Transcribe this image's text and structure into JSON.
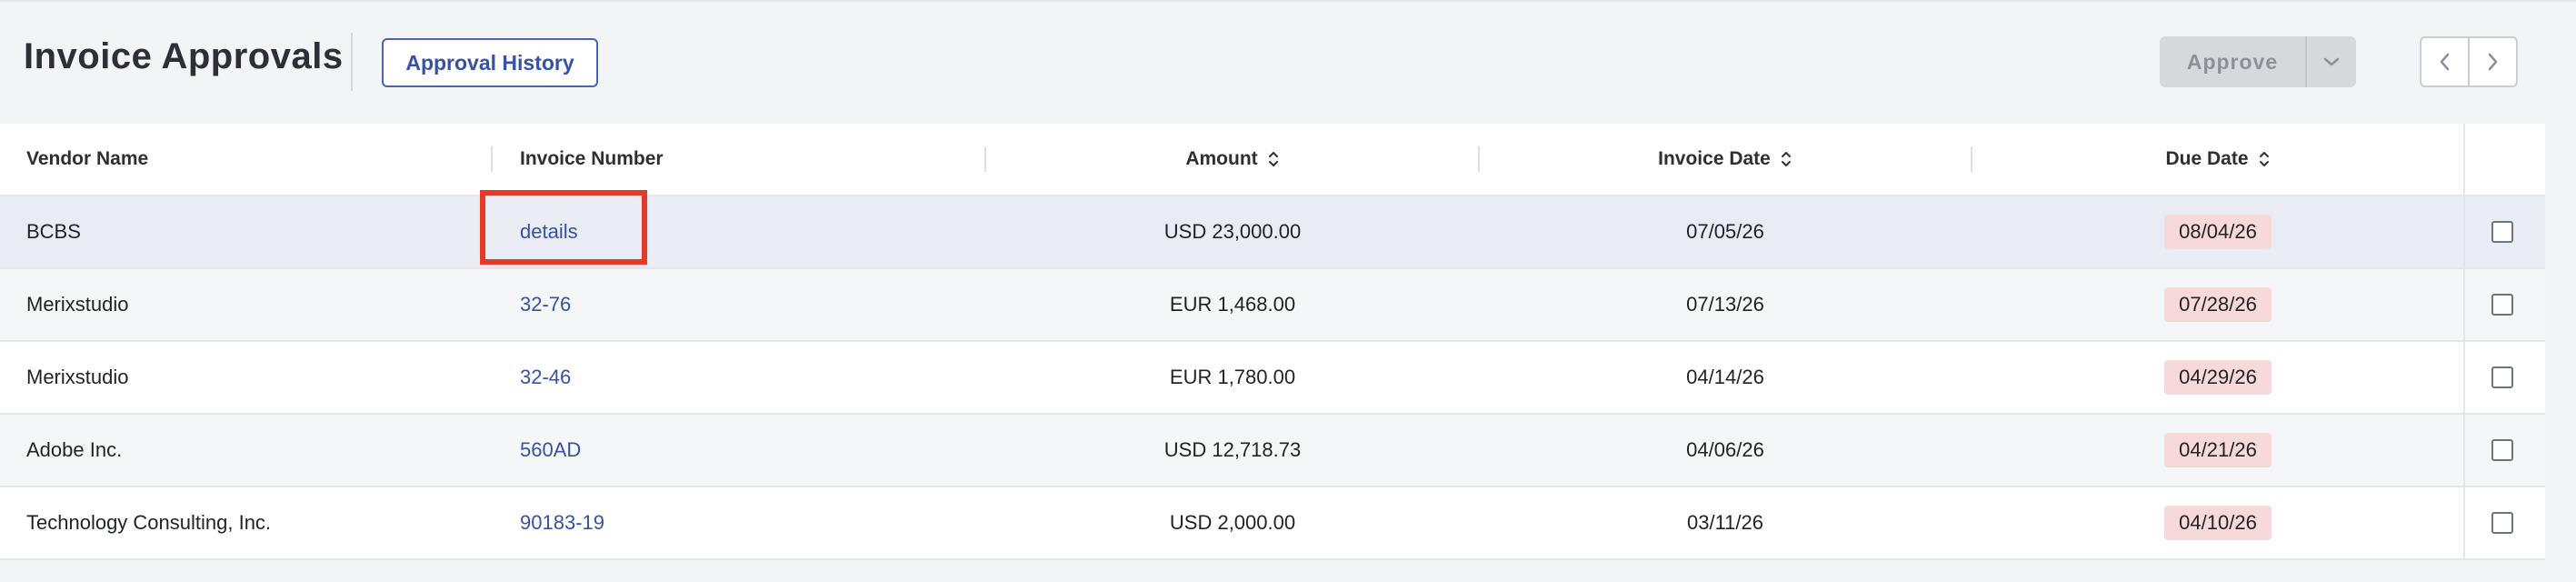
{
  "header": {
    "title": "Invoice Approvals",
    "history_label": "Approval History",
    "approve_label": "Approve"
  },
  "table": {
    "columns": {
      "vendor": "Vendor Name",
      "invoice": "Invoice Number",
      "amount": "Amount",
      "invoice_date": "Invoice Date",
      "due_date": "Due Date"
    },
    "rows": [
      {
        "vendor": "BCBS",
        "invoice": "details",
        "amount": "USD 23,000.00",
        "invoice_date": "07/05/26",
        "due_date": "08/04/26"
      },
      {
        "vendor": "Merixstudio",
        "invoice": "32-76",
        "amount": "EUR 1,468.00",
        "invoice_date": "07/13/26",
        "due_date": "07/28/26"
      },
      {
        "vendor": "Merixstudio",
        "invoice": "32-46",
        "amount": "EUR 1,780.00",
        "invoice_date": "04/14/26",
        "due_date": "04/29/26"
      },
      {
        "vendor": "Adobe Inc.",
        "invoice": "560AD",
        "amount": "USD 12,718.73",
        "invoice_date": "04/06/26",
        "due_date": "04/21/26"
      },
      {
        "vendor": "Technology Consulting, Inc.",
        "invoice": "90183-19",
        "amount": "USD 2,000.00",
        "invoice_date": "03/11/26",
        "due_date": "04/10/26"
      }
    ]
  },
  "colors": {
    "accent": "#3551a8",
    "due_badge": "#f8d9d9",
    "highlight": "#e53a25"
  },
  "icons": {
    "approve_caret": "chevron-down-icon",
    "pager_prev": "chevron-left-icon",
    "pager_next": "chevron-right-icon",
    "sort": "sort-icon"
  }
}
